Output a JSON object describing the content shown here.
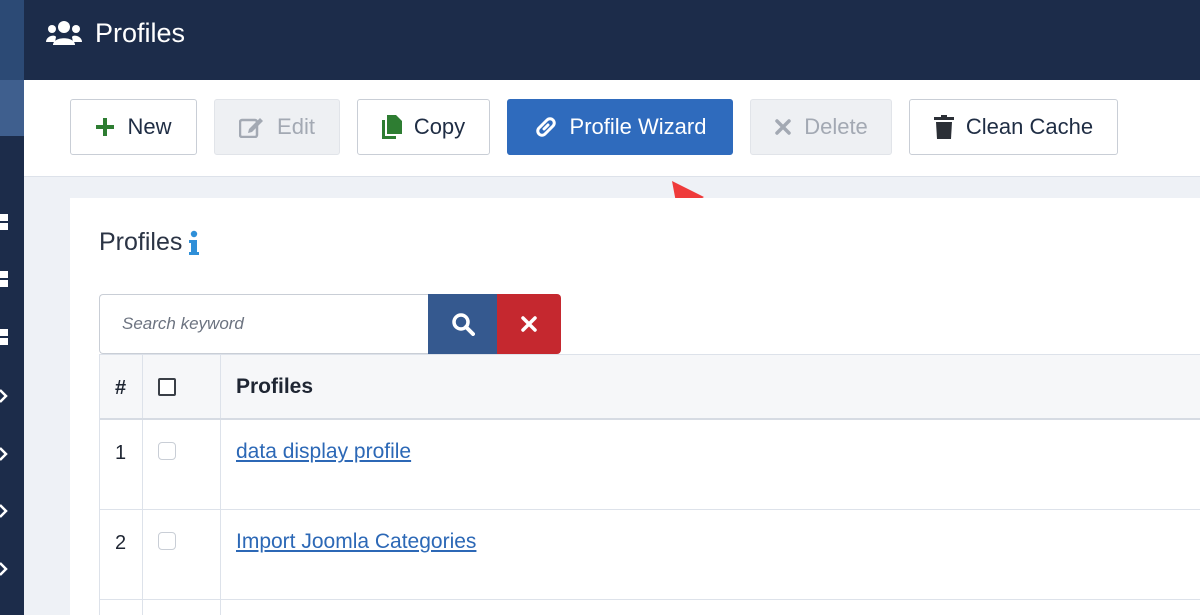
{
  "header": {
    "title": "Profiles",
    "icon": "users-icon"
  },
  "toolbar": {
    "new_label": "New",
    "edit_label": "Edit",
    "copy_label": "Copy",
    "wizard_label": "Profile Wizard",
    "delete_label": "Delete",
    "clean_cache_label": "Clean Cache"
  },
  "main": {
    "section_title": "Profiles",
    "search": {
      "placeholder": "Search keyword",
      "value": ""
    },
    "table": {
      "headers": {
        "num": "#",
        "name": "Profiles"
      },
      "rows": [
        {
          "num": "1",
          "name": "data display profile"
        },
        {
          "num": "2",
          "name": "Import Joomla Categories"
        }
      ]
    }
  },
  "colors": {
    "header_bg": "#1c2c4a",
    "primary": "#2f6bbd",
    "search_btn": "#35598f",
    "clear_btn": "#c5282f",
    "new_icon": "#2e7d32",
    "copy_icon": "#2e7d32",
    "link": "#2c68b6",
    "info_icon": "#2f8fd8",
    "annotation_arrow": "#ef3b3b"
  }
}
